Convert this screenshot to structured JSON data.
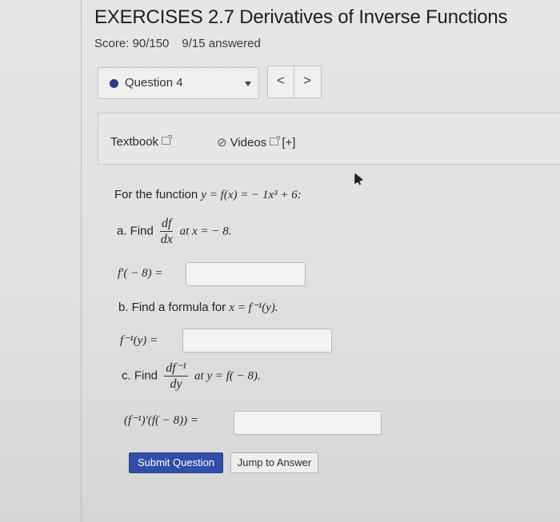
{
  "header": {
    "title": "EXERCISES 2.7 Derivatives of Inverse Functions",
    "score": "Score: 90/150",
    "answered": "9/15 answered"
  },
  "question_nav": {
    "current": "Question 4",
    "prev": "<",
    "next": ">"
  },
  "toolbar": {
    "textbook": "Textbook",
    "videos": "Videos",
    "expand": "[+]"
  },
  "problem": {
    "intro_prefix": "For the function ",
    "intro_math": "y = f(x) =  − 1x³ + 6:",
    "part_a": {
      "find": "a. Find",
      "frac_num": "df",
      "frac_den": "dx",
      "condition": "at x =  − 8.",
      "answer_label": "f′( − 8) =",
      "answer_value": ""
    },
    "part_b": {
      "text_prefix": "b. Find a formula for ",
      "text_math": "x = f⁻¹(y).",
      "answer_label": "f⁻¹(y) =",
      "answer_value": ""
    },
    "part_c": {
      "find": "c. Find",
      "frac_num": "df⁻¹",
      "frac_den": "dy",
      "condition": "at y = f( − 8).",
      "answer_label": "(f⁻¹)′(f( − 8)) =",
      "answer_value": ""
    }
  },
  "actions": {
    "submit": "Submit Question",
    "jump": "Jump to Answer"
  },
  "colors": {
    "primary_button": "#2f4fa8",
    "question_dot": "#2d3a8c",
    "background": "#e4e4e2"
  }
}
